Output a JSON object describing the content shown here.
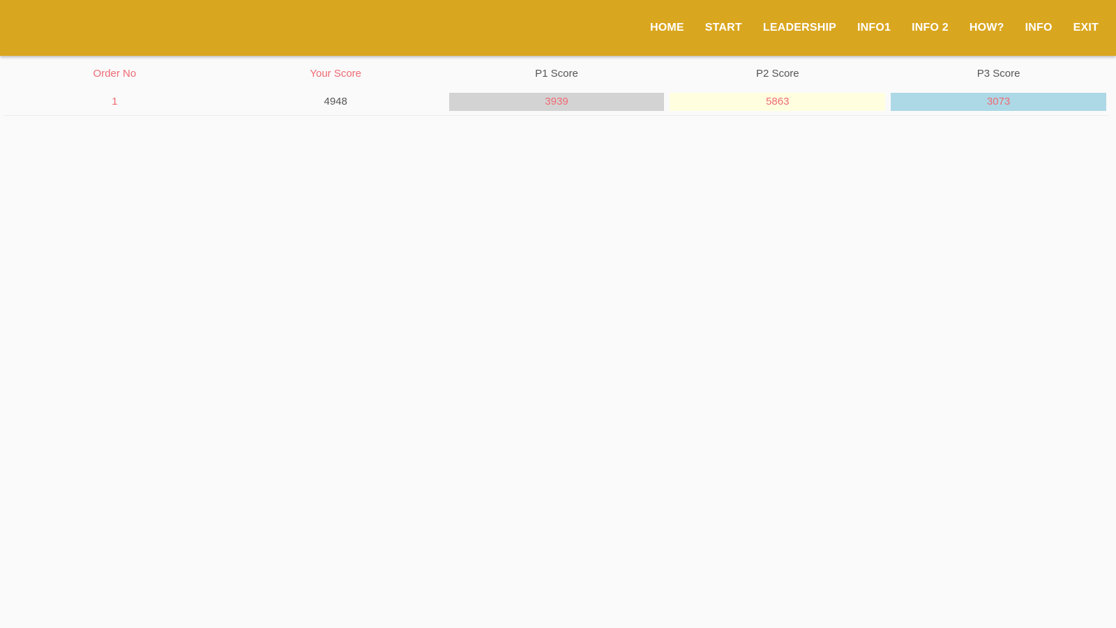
{
  "nav": {
    "items": [
      {
        "label": "HOME"
      },
      {
        "label": "START"
      },
      {
        "label": "LEADERSHIP"
      },
      {
        "label": "INFO1"
      },
      {
        "label": "INFO 2"
      },
      {
        "label": "HOW?"
      },
      {
        "label": "INFO"
      },
      {
        "label": "EXIT"
      }
    ]
  },
  "table": {
    "headers": {
      "order_no": "Order No",
      "your_score": "Your Score",
      "p1_score": "P1 Score",
      "p2_score": "P2 Score",
      "p3_score": "P3 Score"
    },
    "rows": [
      {
        "order_no": "1",
        "your_score": "4948",
        "p1_score": "3939",
        "p2_score": "5863",
        "p3_score": "3073"
      }
    ]
  },
  "colors": {
    "app_bar": "#d9a61f",
    "accent_text": "#f06a73",
    "p1_cell": "#d3d3d3",
    "p2_cell": "#ffffe0",
    "p3_cell": "#add8e6",
    "background": "#fafafa"
  }
}
